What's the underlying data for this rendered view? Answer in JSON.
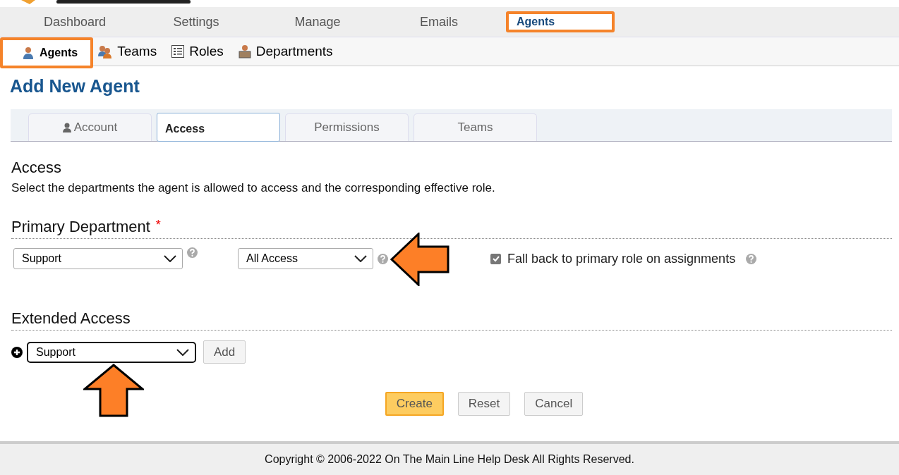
{
  "nav": [
    {
      "label": "Dashboard",
      "selected": false,
      "highlighted": false
    },
    {
      "label": "Settings",
      "selected": false,
      "highlighted": false
    },
    {
      "label": "Manage",
      "selected": false,
      "highlighted": false
    },
    {
      "label": "Emails",
      "selected": false,
      "highlighted": false
    },
    {
      "label": "Agents",
      "selected": true,
      "highlighted": true
    }
  ],
  "subnav": [
    {
      "label": "Agents",
      "selected": true,
      "highlighted": true
    },
    {
      "label": "Teams",
      "selected": false,
      "highlighted": false
    },
    {
      "label": "Roles",
      "selected": false,
      "highlighted": false
    },
    {
      "label": "Departments",
      "selected": false,
      "highlighted": false
    }
  ],
  "page_title": "Add New Agent",
  "tabs": [
    {
      "label": "Account",
      "selected": false
    },
    {
      "label": "Access",
      "selected": true
    },
    {
      "label": "Permissions",
      "selected": false
    },
    {
      "label": "Teams",
      "selected": false
    }
  ],
  "section": {
    "title": "Access",
    "description": "Select the departments the agent is allowed to access and the corresponding effective role."
  },
  "primary": {
    "title": "Primary Department",
    "required": "*",
    "department": "Support",
    "role": "All Access",
    "fallback": {
      "label": "Fall back to primary role on assignments",
      "checked": true
    }
  },
  "extended": {
    "title": "Extended Access",
    "department": "Support",
    "add_button": "Add"
  },
  "buttons": [
    {
      "label": "Create",
      "primary": true
    },
    {
      "label": "Reset",
      "primary": false
    },
    {
      "label": "Cancel",
      "primary": false
    }
  ],
  "footer": "Copyright © 2006-2022 On The Main Line Help Desk All Rights Reserved."
}
